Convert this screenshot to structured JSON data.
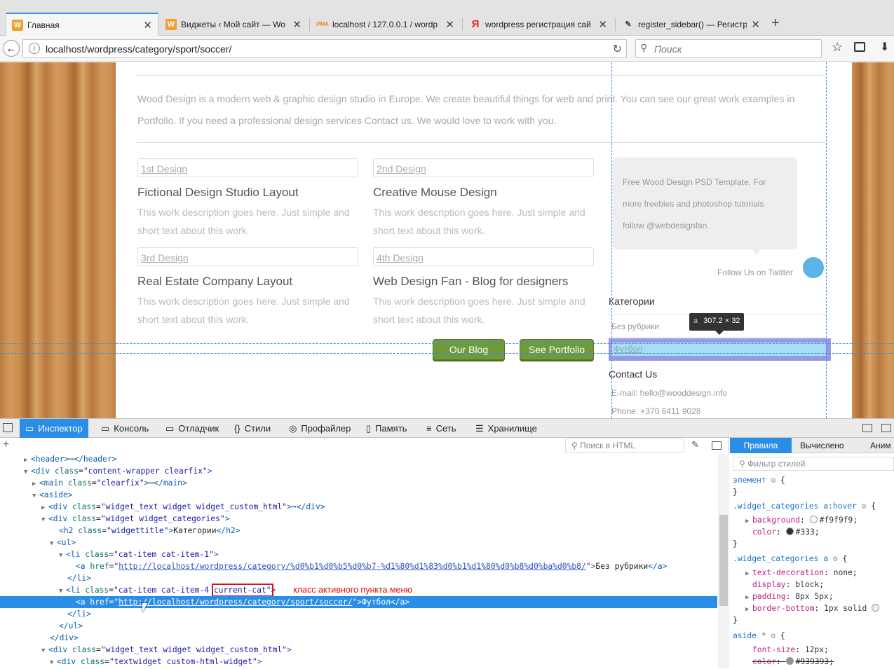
{
  "browser": {
    "tabs": [
      {
        "title": "Главная",
        "active": true,
        "favicon": "W"
      },
      {
        "title": "Виджеты ‹ Мой сайт — Wo",
        "active": false,
        "favicon": "W"
      },
      {
        "title": "localhost / 127.0.0.1 / wordp",
        "active": false,
        "favicon": "PMA"
      },
      {
        "title": "wordpress регистрация сай",
        "active": false,
        "favicon": "Я"
      },
      {
        "title": "register_sidebar() — Регистр",
        "active": false,
        "favicon": "✎"
      }
    ],
    "new_tab_icon": "+",
    "url": "localhost/wordpress/category/sport/soccer/",
    "search_placeholder": "Поиск"
  },
  "page": {
    "intro_line1": "Wood Design is a modern web & graphic design studio in Europe. We create beautiful things for web and print. You can see our great work examples in",
    "intro_line2": "Portfolio. If you need a professional design services Contact us. We would love to work with you.",
    "designs": [
      {
        "label": "1st Design",
        "title": "Fictional Design Studio Layout",
        "desc1": "This work description goes here. Just simple and",
        "desc2": "short text about this work."
      },
      {
        "label": "2nd Design",
        "title": "Creative Mouse Design",
        "desc1": "This work description goes here. Just simple and",
        "desc2": "short text about this work."
      },
      {
        "label": "3rd Design",
        "title": "Real Estate Company Layout",
        "desc1": "This work description goes here. Just simple and",
        "desc2": "short text about this work."
      },
      {
        "label": "4th Design",
        "title": "Web Design Fan - Blog for designers",
        "desc1": "This work description goes here. Just simple and",
        "desc2": "short text about this work."
      }
    ],
    "buttons": {
      "blog": "Our Blog",
      "portfolio": "See Portfolio"
    },
    "tweet": {
      "line1": "Free Wood Design PSD Template. For",
      "line2": "more freebies and photoshop tutorials",
      "line3": "follow @webdesignfan.",
      "follow": "Follow Us on Twitter"
    },
    "categories": {
      "title": "Категории",
      "items": [
        "Без рубрики",
        "Футбол"
      ]
    },
    "highlight_tooltip": {
      "tag": "a",
      "size": "307.2 × 32"
    },
    "contact": {
      "title": "Contact Us",
      "email": "E-mail: hello@wooddesign.info",
      "phone": "Phone: +370 6411 9028"
    }
  },
  "devtools": {
    "tabs": [
      "Инспектор",
      "Консоль",
      "Отладчик",
      "Стили",
      "Профайлер",
      "Память",
      "Сеть",
      "Хранилище"
    ],
    "html_search_placeholder": "Поиск в HTML",
    "annotation": "класс активного пункта меню",
    "rules_tabs": [
      "Правила",
      "Вычислено",
      "Аним"
    ],
    "filter_placeholder": "Фильтр стилей"
  },
  "colors": {
    "accent": "#2b8ee6",
    "button_green": "#6f9a3c",
    "highlight": "#9fd3f5"
  }
}
